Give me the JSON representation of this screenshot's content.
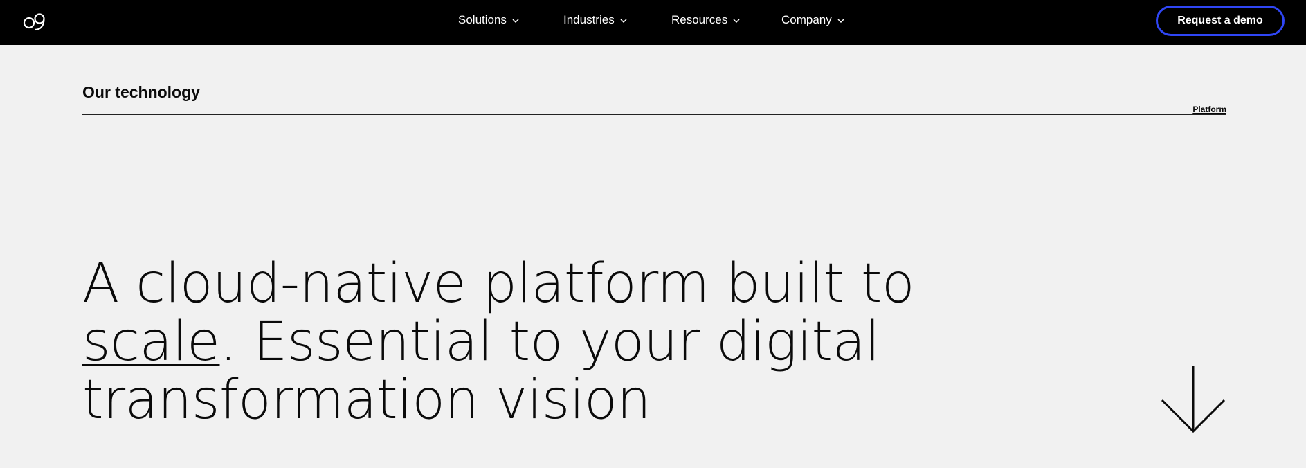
{
  "header": {
    "logo_text": "o9",
    "menu": [
      {
        "label": "Solutions"
      },
      {
        "label": "Industries"
      },
      {
        "label": "Resources"
      },
      {
        "label": "Company"
      }
    ],
    "cta_label": "Request a demo",
    "cta_border_color": "#2f46f5"
  },
  "section": {
    "title": "Our technology",
    "link_label": "Platform"
  },
  "hero": {
    "line1": "A cloud-native platform built to",
    "underlined_word": "scale",
    "line2_rest": ". Essential to your digital",
    "line3": "transformation vision",
    "scroll_icon": "arrow-down-icon"
  }
}
